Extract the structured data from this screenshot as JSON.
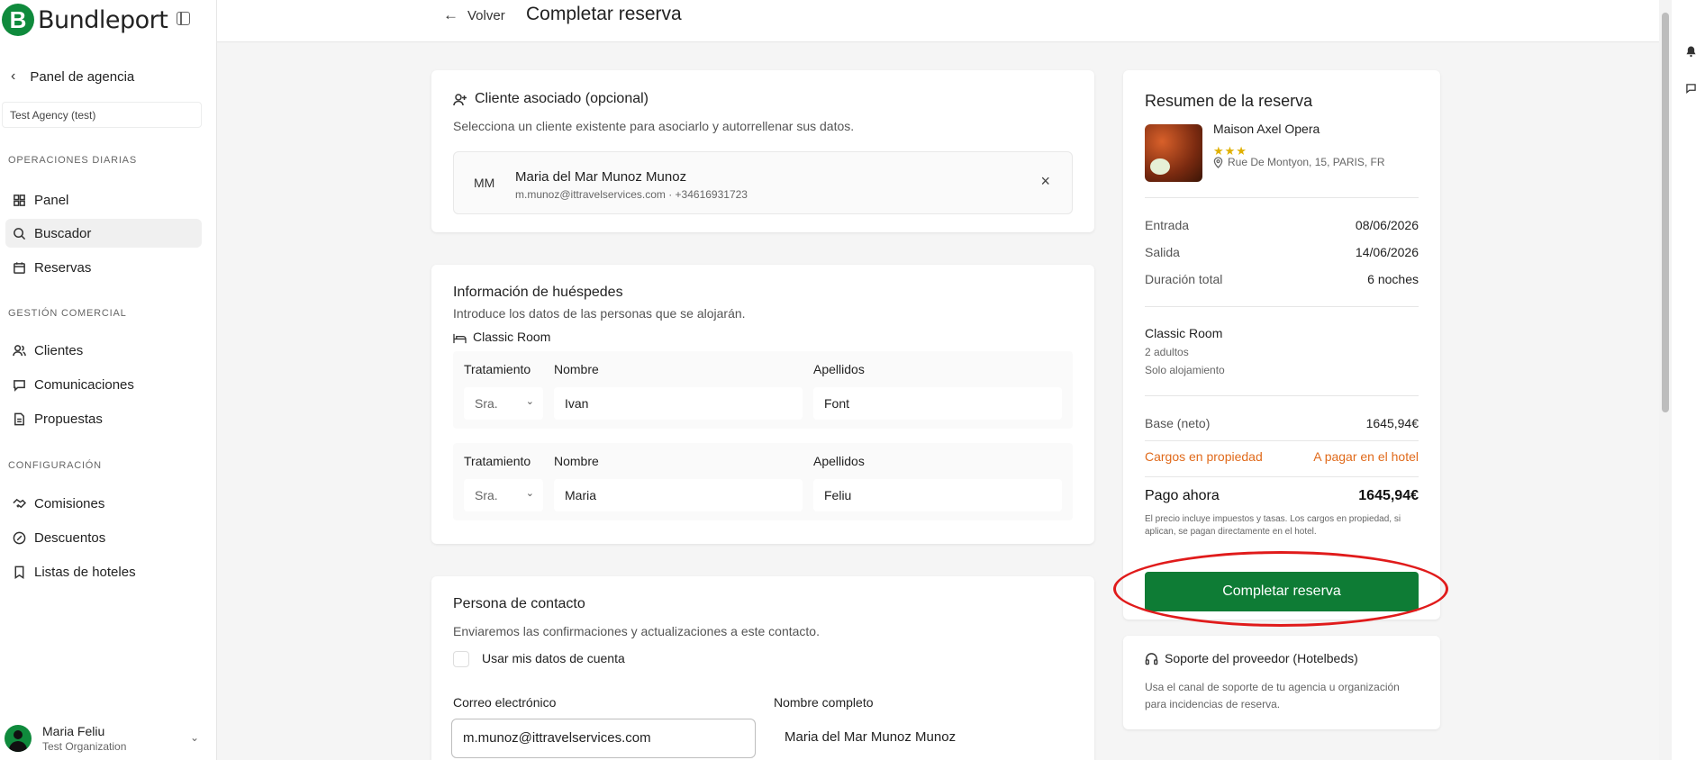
{
  "brand": {
    "name": "Bundleport",
    "logo_letter": "B",
    "color": "#0f8a3c"
  },
  "sidebar": {
    "back_label": "Panel de agencia",
    "tenant": "Test Agency (test)",
    "sections": [
      {
        "label": "OPERACIONES DIARIAS",
        "items": [
          "Panel",
          "Buscador",
          "Reservas"
        ]
      },
      {
        "label": "GESTIÓN COMERCIAL",
        "items": [
          "Clientes",
          "Comunicaciones",
          "Propuestas"
        ]
      },
      {
        "label": "CONFIGURACIÓN",
        "items": [
          "Comisiones",
          "Descuentos",
          "Listas de hoteles"
        ]
      }
    ],
    "active_item": "Buscador",
    "user": {
      "name": "Maria Feliu",
      "org": "Test Organization"
    }
  },
  "header": {
    "back_label": "Volver",
    "title": "Completar reserva"
  },
  "client_card": {
    "title": "Cliente asociado (opcional)",
    "subtitle": "Selecciona un cliente existente para asociarlo y autorrellenar sus datos.",
    "initials": "MM",
    "name": "Maria del Mar Munoz Munoz",
    "contact": "m.munoz@ittravelservices.com · +34616931723"
  },
  "guests_card": {
    "title": "Información de huéspedes",
    "subtitle": "Introduce los datos de las personas que se alojarán.",
    "room": "Classic Room",
    "labels": {
      "treatment": "Tratamiento",
      "first_name": "Nombre",
      "last_name": "Apellidos"
    },
    "guests": [
      {
        "treatment": "Sra.",
        "first_name": "Ivan",
        "last_name": "Font"
      },
      {
        "treatment": "Sra.",
        "first_name": "Maria",
        "last_name": "Feliu"
      }
    ]
  },
  "contact_card": {
    "title": "Persona de contacto",
    "subtitle": "Enviaremos las confirmaciones y actualizaciones a este contacto.",
    "use_account_label": "Usar mis datos de cuenta",
    "email_label": "Correo electrónico",
    "email_value": "m.munoz@ittravelservices.com",
    "fullname_label": "Nombre completo",
    "fullname_value": "Maria del Mar Munoz Munoz"
  },
  "summary": {
    "title": "Resumen de la reserva",
    "hotel_name": "Maison Axel Opera",
    "stars": "★★★",
    "address": "Rue De Montyon, 15, PARIS, FR",
    "checkin_label": "Entrada",
    "checkin": "08/06/2026",
    "checkout_label": "Salida",
    "checkout": "14/06/2026",
    "duration_label": "Duración total",
    "duration": "6 noches",
    "room": "Classic Room",
    "occupancy": "2 adultos",
    "board": "Solo alojamiento",
    "base_label": "Base (neto)",
    "base": "1645,94€",
    "charges_label": "Cargos en propiedad",
    "charges": "A pagar en el hotel",
    "charges_color": "#e06a1b",
    "pay_label": "Pago ahora",
    "pay": "1645,94€",
    "note": "El precio incluye impuestos y tasas. Los cargos en propiedad, si aplican, se pagan directamente en el hotel.",
    "cta": "Completar reserva",
    "cta_color": "#0e7c35"
  },
  "support": {
    "title": "Soporte del proveedor (Hotelbeds)",
    "text": "Usa el canal de soporte de tu agencia u organización para incidencias de reserva."
  }
}
